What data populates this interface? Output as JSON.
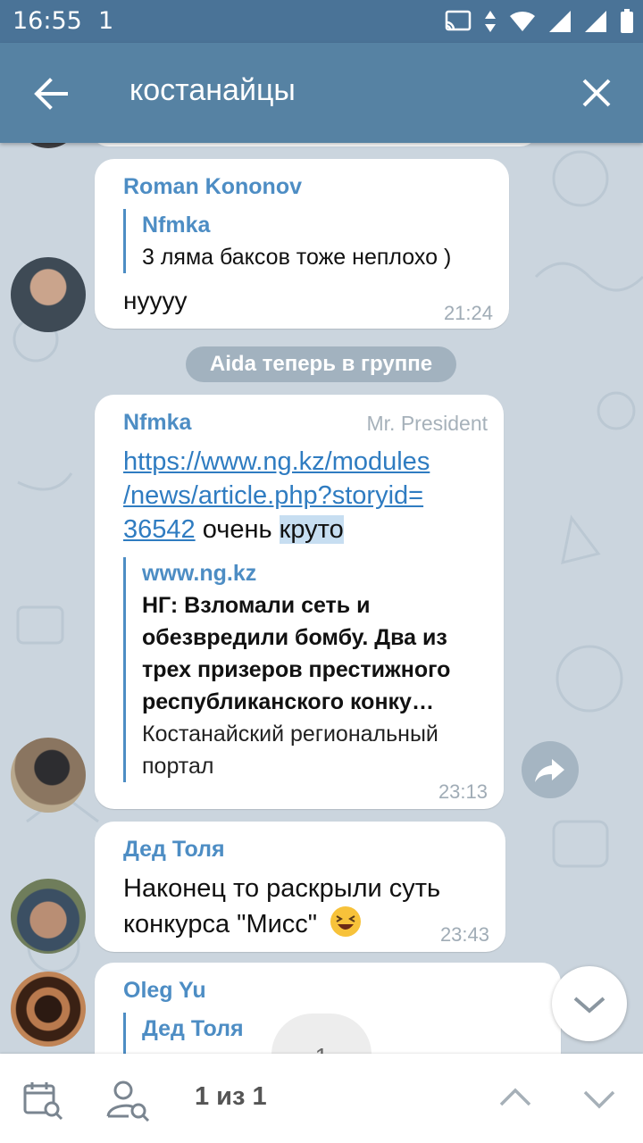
{
  "status_bar": {
    "time": "16:55",
    "notification_count": "1"
  },
  "header": {
    "search_query": "костанайцы"
  },
  "messages": [
    {
      "sender": "Roman Kononov",
      "reply_to": {
        "name": "Nfmka",
        "text": "3 ляма баксов тоже неплохо )"
      },
      "text": "нуууу",
      "time": "21:24"
    },
    {
      "sender": "Nfmka",
      "title": "Mr. President",
      "link_line1": "https://www.ng.kz/modules",
      "link_line2": "/news/article.php?storyid=",
      "link_line3": "36542",
      "text_after": "очень ",
      "highlight": "круто",
      "preview": {
        "site": "www.ng.kz",
        "title_lines": [
          "НГ: Взломали сеть и",
          "обезвредили бомбу. Два из",
          "трех призеров престижного",
          "республиканского конку…"
        ],
        "desc_lines": [
          "Костанайский региональный",
          "портал"
        ]
      },
      "time": "23:13"
    },
    {
      "sender": "Дед Толя",
      "text_line1": "Наконец то раскрыли суть",
      "text_line2": "конкурса \"Мисс\"",
      "time": "23:43"
    },
    {
      "sender": "Oleg Yu",
      "reply_to": {
        "name": "Дед Толя"
      }
    }
  ],
  "service_message": "Aida теперь в группе",
  "page_indicator": "1",
  "bottom_bar": {
    "counter": "1 из 1"
  }
}
